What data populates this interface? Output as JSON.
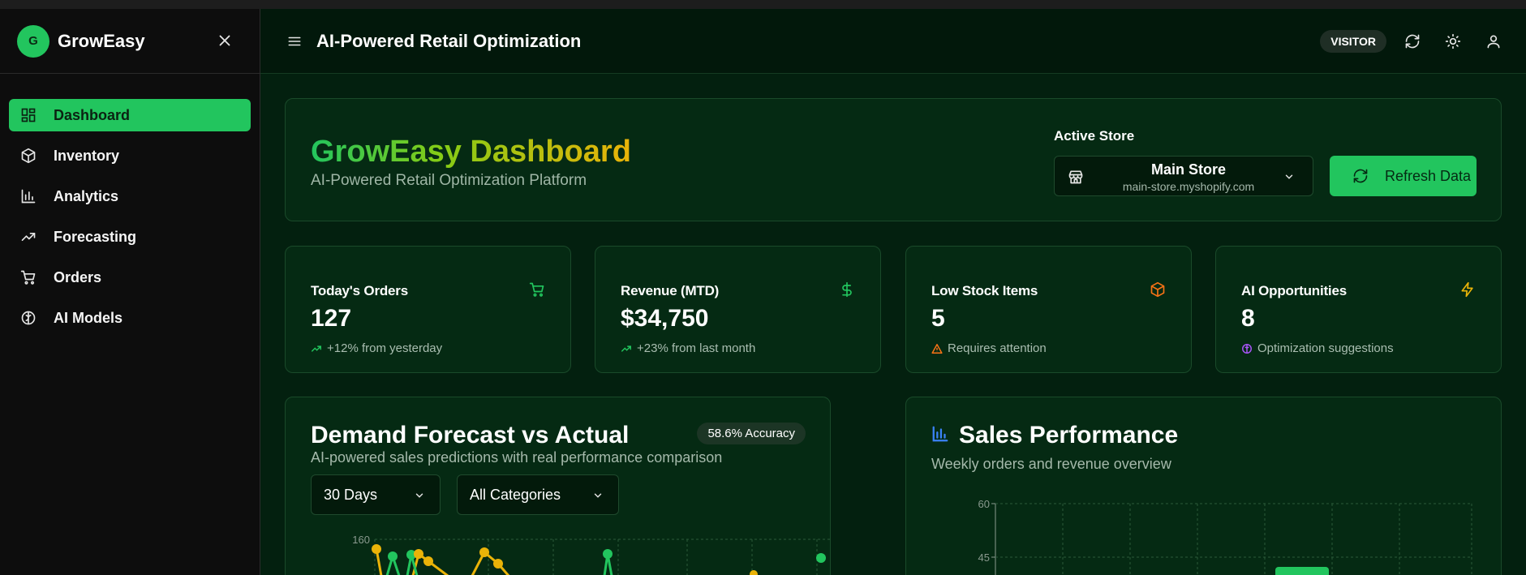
{
  "sidebar": {
    "logo_letter": "G",
    "brand": "GrowEasy",
    "items": [
      {
        "label": "Dashboard",
        "icon": "dashboard-icon",
        "active": true
      },
      {
        "label": "Inventory",
        "icon": "box-icon",
        "active": false
      },
      {
        "label": "Analytics",
        "icon": "bar-chart-icon",
        "active": false
      },
      {
        "label": "Forecasting",
        "icon": "trend-icon",
        "active": false
      },
      {
        "label": "Orders",
        "icon": "cart-icon",
        "active": false
      },
      {
        "label": "AI Models",
        "icon": "brain-icon",
        "active": false
      }
    ]
  },
  "header": {
    "title": "AI-Powered Retail Optimization",
    "role_badge": "VISITOR"
  },
  "hero": {
    "title": "GrowEasy Dashboard",
    "subtitle": "AI-Powered Retail Optimization Platform",
    "active_store_label": "Active Store",
    "store_name": "Main Store",
    "store_url": "main-store.myshopify.com",
    "refresh_label": "Refresh Data"
  },
  "stats": [
    {
      "title": "Today's Orders",
      "value": "127",
      "note": "+12% from yesterday",
      "icon": "cart-icon",
      "color": "#22c55e"
    },
    {
      "title": "Revenue (MTD)",
      "value": "$34,750",
      "note": "+23% from last month",
      "icon": "dollar-icon",
      "color": "#22c55e"
    },
    {
      "title": "Low Stock Items",
      "value": "5",
      "note": "Requires attention",
      "icon": "box-icon",
      "color": "#f97316"
    },
    {
      "title": "AI Opportunities",
      "value": "8",
      "note": "Optimization suggestions",
      "icon": "zap-icon",
      "color": "#eab308"
    }
  ],
  "forecast": {
    "title": "Demand Forecast vs Actual",
    "subtitle": "AI-powered sales predictions with real performance comparison",
    "accuracy": "58.6% Accuracy",
    "range_value": "30 Days",
    "category_value": "All Categories",
    "y_tick_top": "160"
  },
  "sales": {
    "title": "Sales Performance",
    "subtitle": "Weekly orders and revenue overview",
    "y_ticks": [
      "60",
      "45"
    ]
  },
  "colors": {
    "accent": "#22c55e",
    "forecast_line": "#eab308",
    "actual_line": "#22c55e"
  }
}
